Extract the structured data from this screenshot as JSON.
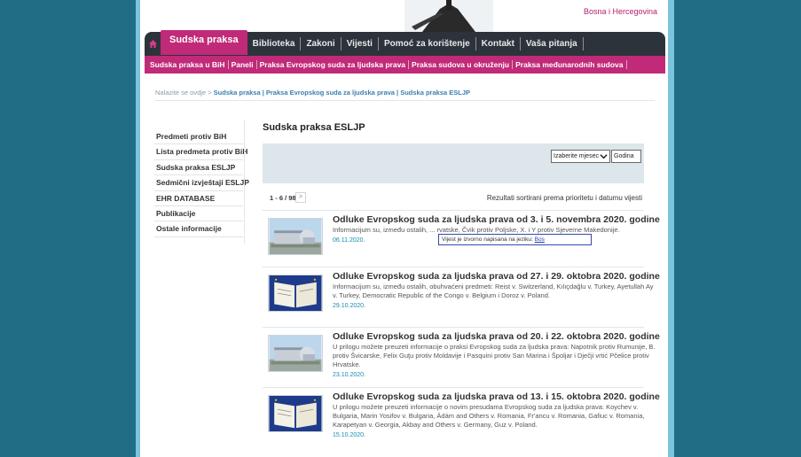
{
  "header": {
    "region": "Bosna i Hercegovina"
  },
  "main_nav": {
    "active": "Sudska praksa",
    "items": [
      "Biblioteka",
      "Zakoni",
      "Vijesti",
      "Pomoć za korištenje",
      "Kontakt",
      "Vaša pitanja"
    ]
  },
  "sub_nav": {
    "items": [
      "Sudska praksa u BiH",
      "Paneli",
      "Praksa Evropskog suda za ljudska prava",
      "Praksa sudova u okruženju",
      "Praksa međunarodnih sudova"
    ]
  },
  "breadcrumb": {
    "prefix": "Nalazite se ovdje > ",
    "path": "Sudska praksa | Praksa Evropskog suda za ljudska prava | Sudska praksa ESLJP"
  },
  "sidebar": {
    "items": [
      "Predmeti protiv BiH",
      "Lista predmeta protiv BiH",
      "Sudska praksa ESLJP",
      "Sedmični izvještaji ESLJP",
      "EHR DATABASE",
      "Publikacije",
      "Ostale informacije"
    ]
  },
  "content": {
    "title": "Sudska praksa ESLJP",
    "month_select": "Izaberite mjesec",
    "year_placeholder": "Godina",
    "pager_count": "1 - 6 / 98",
    "pager_next": ">",
    "sort_note": "Rezultati sortirani prema prioritetu i datumu vijesti"
  },
  "tooltip": {
    "text": "Vijest je izvorno napisana na jeziku: ",
    "lang": "Bos"
  },
  "news": [
    {
      "title": "Odluke Evropskog suda za ljudska prava od 3. i 5. novembra 2020. godine",
      "text": "Informacijum su, između ostalih, ... rvatske, Čvik protiv Poljske, X. i Y protiv Sjeverne Makedonije.",
      "date": "06.11.2020.",
      "thumb": "building"
    },
    {
      "title": "Odluke Evropskog suda za ljudska prava od 27. i 29. oktobra 2020. godine",
      "text": "Informacijum su, između ostalih, obuhvaćeni predmeti: Reist v. Switzerland, Kılıçdağlu v. Turkey, Ayetullah Ay v. Turkey, Democratic Republic of the Congo v. Belgium i Doroz v. Poland.",
      "date": "29.10.2020.",
      "thumb": "book"
    },
    {
      "title": "Odluke Evropskog suda za ljudska prava od 20. i 22. oktobra 2020. godine",
      "text": "U prilogu možete preuzeti informacije o praksi Evropskog suda za ljudska prava: Napotnik protiv Rumunije, B. protiv Švicarske, Felix Guţu protiv Moldavije i Pasquini protiv San Marina i Špoljar i Dječji vrtić Pčelice protiv Hrvatske.",
      "date": "23.10.2020.",
      "thumb": "building"
    },
    {
      "title": "Odluke Evropskog suda za ljudska prava od 13. i 15. oktobra 2020. godine",
      "text": "U prilogu možete preuzeti informacije o novim presudama Evropskog suda za ljudska prava: Koychev v. Bulgaria, Marin Yosifov v. Bulgaria, Ádám and Others v. Romania, Fr'ancu v. Romania, Gafiuc v. Romania, Karapetyan v. Georgia, Akbay and Others v. Germany, Guz v. Poland.",
      "date": "15.10.2020.",
      "thumb": "book"
    }
  ]
}
